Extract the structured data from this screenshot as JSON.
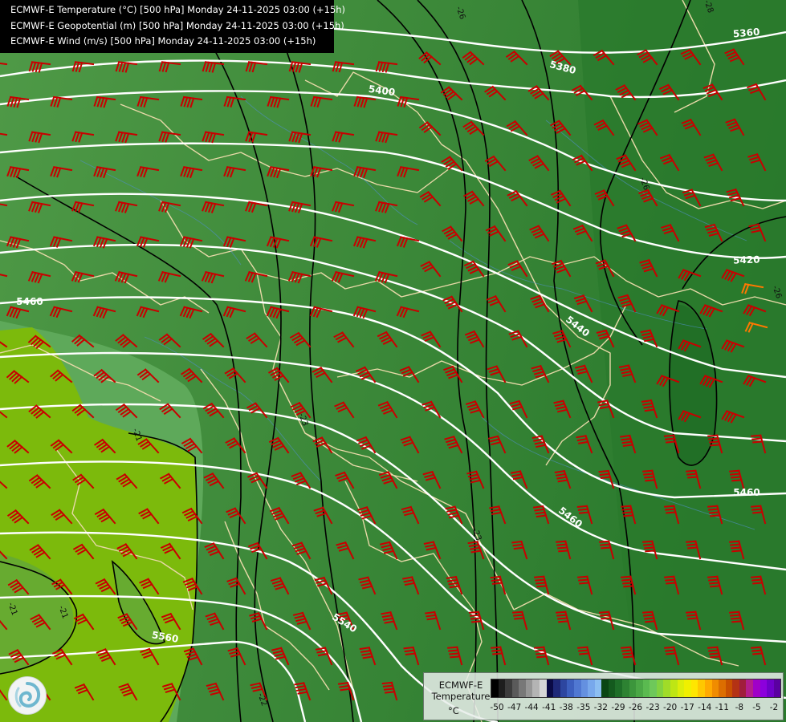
{
  "header": {
    "line1": "ECMWF-E Temperature (°C) [500 hPa] Monday 24-11-2025 03:00 (+15h)",
    "line2": "ECMWF-E Geopotential (m) [500 hPa] Monday 24-11-2025 03:00 (+15h)",
    "line3": "ECMWF-E Wind (m/s) [500 hPa] Monday 24-11-2025 03:00 (+15h)"
  },
  "contours": {
    "geopotential_labels": [
      "5360",
      "5380",
      "5400",
      "5420",
      "5440",
      "5460",
      "5460",
      "5460",
      "5540",
      "5560"
    ],
    "temperature_labels": [
      "-26",
      "-23",
      "-23",
      "-21",
      "-21",
      "-22",
      "-21",
      "-26",
      "-28",
      "-26"
    ]
  },
  "legend": {
    "name": "ECMWF-E\nTemperature",
    "unit": "°C",
    "ticks": [
      "-50",
      "-47",
      "-44",
      "-41",
      "-38",
      "-35",
      "-32",
      "-29",
      "-26",
      "-23",
      "-20",
      "-17",
      "-14",
      "-11",
      "-8",
      "-5",
      "-2"
    ],
    "colors": [
      "#000000",
      "#1e1e1e",
      "#3c3c3c",
      "#5a5a5a",
      "#787878",
      "#969696",
      "#b4b4b4",
      "#d7d7d7",
      "#0a0a46",
      "#1e2878",
      "#2d46a0",
      "#3c5fbe",
      "#5078d2",
      "#6490e0",
      "#78a8ec",
      "#8cbef2",
      "#0a4614",
      "#145a1e",
      "#1e6e28",
      "#2d8232",
      "#3c963c",
      "#4ba846",
      "#5aba50",
      "#6ec85a",
      "#82d240",
      "#a0dc28",
      "#bee614",
      "#dcee0a",
      "#f0f000",
      "#ffe600",
      "#ffc800",
      "#ffaa00",
      "#f08c00",
      "#dc6e00",
      "#c85000",
      "#b43214",
      "#a01e3c",
      "#b41e8c",
      "#a000c8",
      "#8c00dc",
      "#6e00c8",
      "#5a00a0"
    ]
  },
  "colors": {
    "barb": "#c80000",
    "barb_highlight": "#ff7800",
    "geopotential_line": "#ffffff",
    "temperature_line": "#000000",
    "border": "#e8d9a8"
  }
}
